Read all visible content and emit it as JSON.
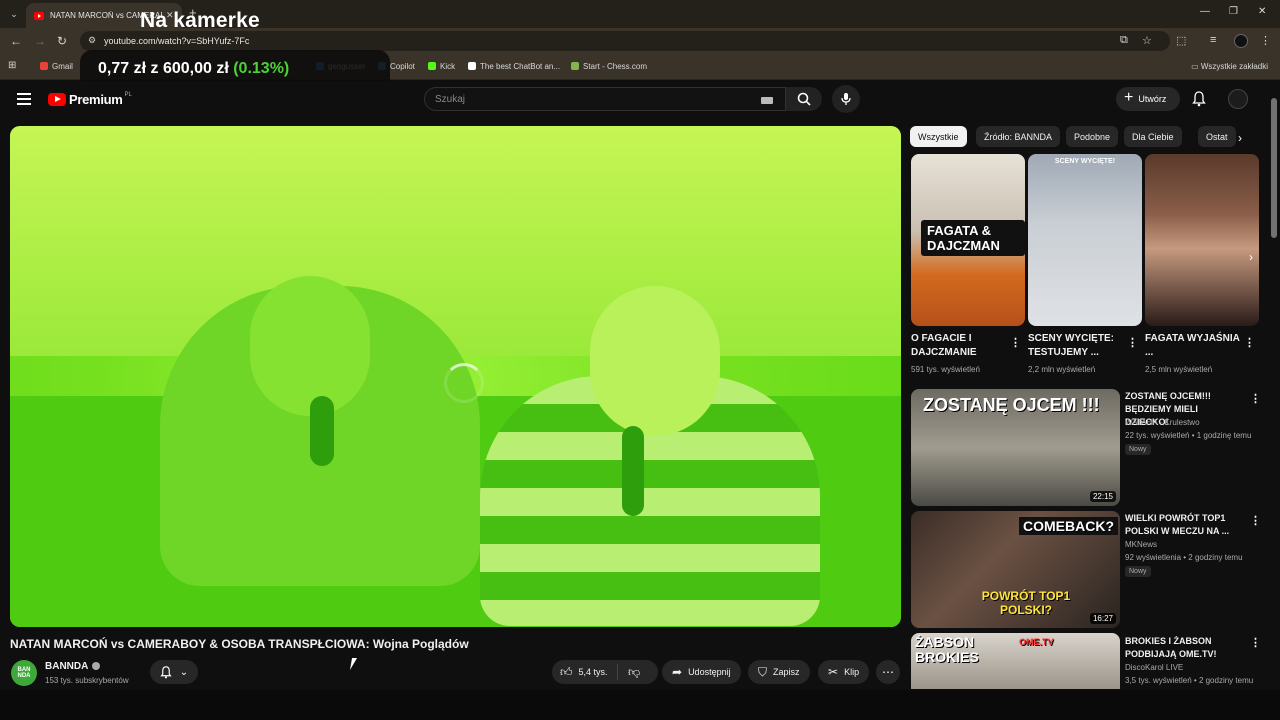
{
  "browser": {
    "tab_title": "NATAN MARCOŃ vs CAMERAB",
    "url": "youtube.com/watch?v=SbHYufz-7Fc",
    "bookmarks": [
      {
        "label": "Gmail",
        "color": "#ea4335"
      },
      {
        "label": "geogusser",
        "color": "#3a8bd8"
      },
      {
        "label": "Copilot",
        "color": "#2aa7a0"
      },
      {
        "label": "Kick",
        "color": "#53fc18"
      },
      {
        "label": "The best ChatBot an...",
        "color": "#ffffff"
      },
      {
        "label": "Start - Chess.com",
        "color": "#81b64c"
      }
    ],
    "all_bookmarks": "Wszystkie zakładki"
  },
  "overlay": {
    "title": "Na kamerke",
    "price_value": "0,77 zł",
    "price_of": "z",
    "price_goal": "600,00 zł",
    "price_pct": "(0.13%)"
  },
  "youtube": {
    "brand": "Premium",
    "region": "PL",
    "search_placeholder": "Szukaj",
    "create_label": "Utwórz"
  },
  "video": {
    "title": "NATAN MARCOŃ vs CAMERABOY & OSOBA TRANSPŁCIOWA: Wojna Poglądów",
    "channel": "BANNDA",
    "channel_avatar_text": "BAN NDA",
    "subscribers": "153 tys. subskrybentów",
    "likes": "5,4 tys.",
    "share": "Udostępnij",
    "save": "Zapisz",
    "clip": "Klip"
  },
  "chips": [
    "Wszystkie",
    "Źródło: BANNDA",
    "Podobne",
    "Dla Ciebie",
    "Ostat"
  ],
  "shorts": [
    {
      "title": "O FAGACIE I DAJCZMANIE",
      "views": "591 tys. wyświetleń",
      "overlay": "FAGATA & DAJCZMAN",
      "caption": ""
    },
    {
      "title": "SCENY WYCIĘTE: TESTUJEMY ...",
      "views": "2,2 mln wyświetleń",
      "overlay": "",
      "caption": "SCENY WYCIĘTE!"
    },
    {
      "title": "FAGATA WYJAŚNIA ...",
      "views": "2,5 mln wyświetleń",
      "overlay": "",
      "caption": ""
    }
  ],
  "recommendations": [
    {
      "thumb_text": "ZOSTANĘ OJCEM !!!",
      "duration": "22:15",
      "title": "ZOSTANĘ OJCEM!!! BĘDZIEMY MIELI DZIECKO!",
      "channel": "WATAHA - Krulestwo",
      "meta": "22 tys. wyświetleń • 1 godzinę temu",
      "badge": "Nowy"
    },
    {
      "thumb_text": "COMEBACK?",
      "thumb_text2": "POWRÓT TOP1 POLSKI?",
      "duration": "16:27",
      "title": "WIELKI POWRÓT TOP1 POLSKI W MECZU NA ...",
      "channel": "MKNews",
      "meta": "92 wyświetlenia • 2 godziny temu",
      "badge": "Nowy"
    },
    {
      "thumb_text": "ŻABSON BROKIES",
      "thumb_text2": "OME.TV",
      "title": "BROKIES I ŻABSON PODBIJAJĄ OME.TV!",
      "channel": "DiscoKarol LIVE",
      "meta": "3,5 tys. wyświetleń • 2 godziny temu"
    }
  ]
}
